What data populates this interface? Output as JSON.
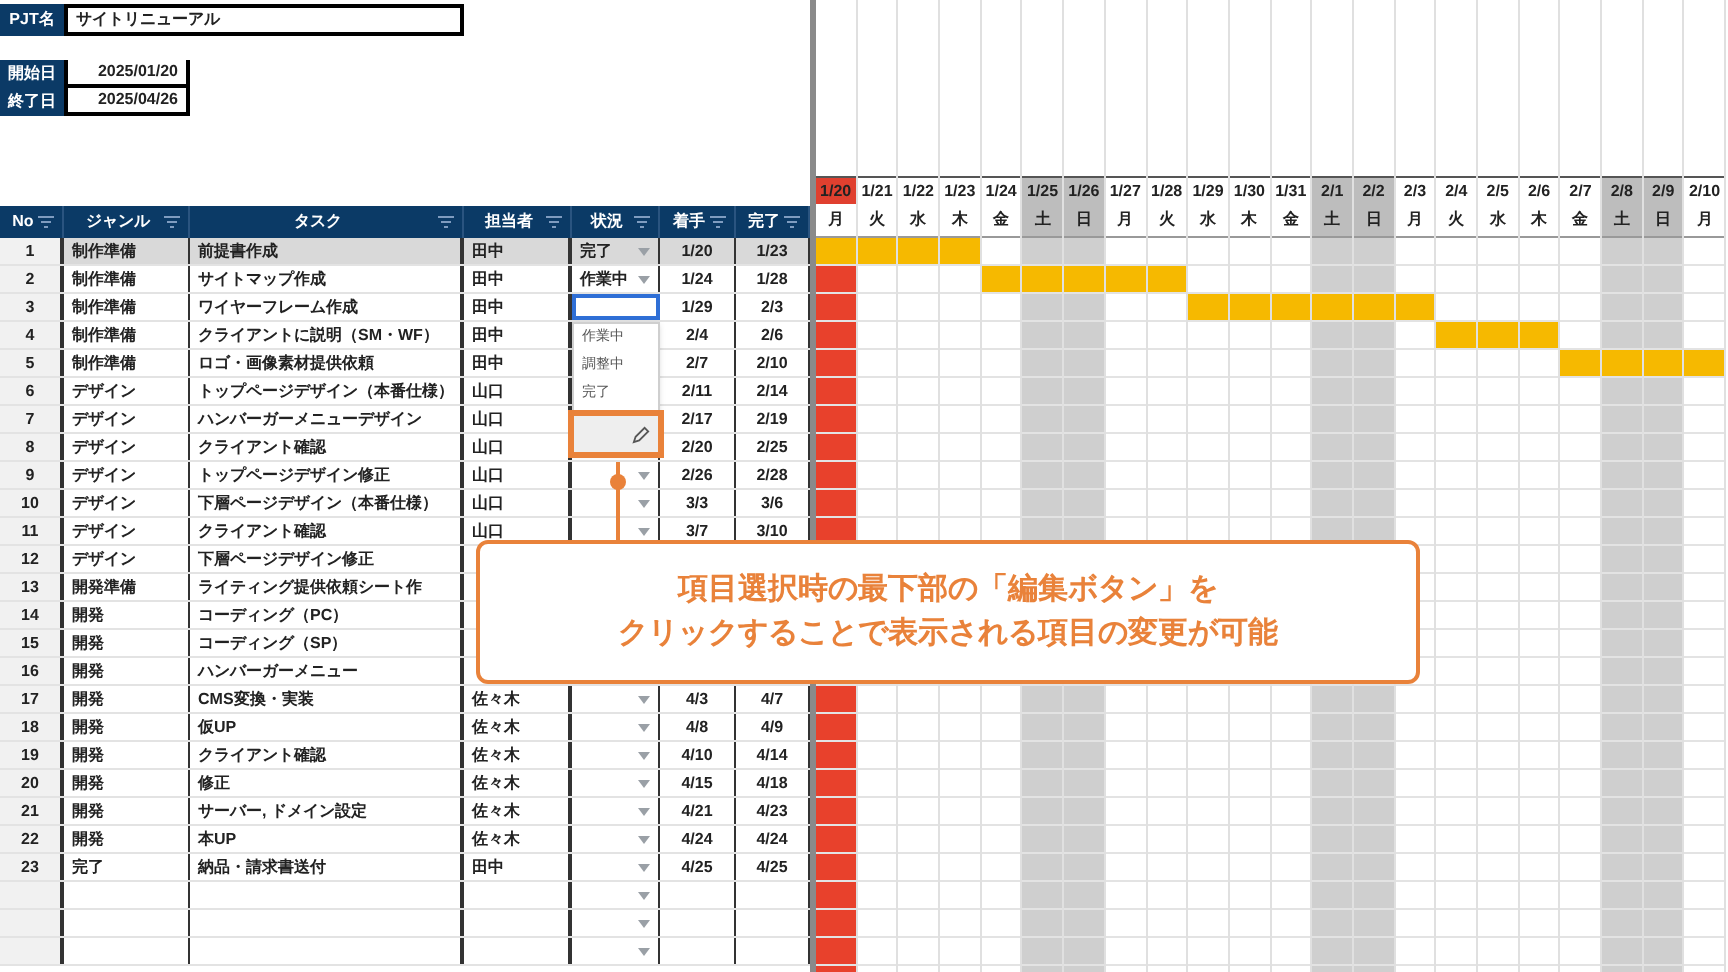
{
  "project": {
    "label": "PJT名",
    "value": "サイトリニューアル"
  },
  "dates": [
    {
      "label": "開始日",
      "value": "2025/01/20"
    },
    {
      "label": "終了日",
      "value": "2025/04/26"
    }
  ],
  "table": {
    "columns": [
      "No",
      "ジャンル",
      "タスク",
      "担当者",
      "状況",
      "着手",
      "完了"
    ],
    "rows": [
      {
        "no": "1",
        "genre": "制作準備",
        "task": "前提書作成",
        "assignee": "田中",
        "status": "完了",
        "start": "1/20",
        "end": "1/23",
        "highlighted": true,
        "status_selected": false,
        "caret": true
      },
      {
        "no": "2",
        "genre": "制作準備",
        "task": "サイトマップ作成",
        "assignee": "田中",
        "status": "作業中",
        "start": "1/24",
        "end": "1/28",
        "highlighted": false,
        "status_selected": false,
        "caret": true
      },
      {
        "no": "3",
        "genre": "制作準備",
        "task": "ワイヤーフレーム作成",
        "assignee": "田中",
        "start": "1/29",
        "end": "2/3",
        "highlighted": false,
        "status_selected": true
      },
      {
        "no": "4",
        "genre": "制作準備",
        "task": "クライアントに説明（SM・WF）",
        "assignee": "田中",
        "start": "2/4",
        "end": "2/6",
        "highlighted": false
      },
      {
        "no": "5",
        "genre": "制作準備",
        "task": "ロゴ・画像素材提供依頼",
        "assignee": "田中",
        "start": "2/7",
        "end": "2/10",
        "highlighted": false
      },
      {
        "no": "6",
        "genre": "デザイン",
        "task": "トップページデザイン（本番仕様）",
        "assignee": "山口",
        "start": "2/11",
        "end": "2/14",
        "highlighted": false
      },
      {
        "no": "7",
        "genre": "デザイン",
        "task": "ハンバーガーメニューデザイン",
        "assignee": "山口",
        "start": "2/17",
        "end": "2/19",
        "highlighted": false
      },
      {
        "no": "8",
        "genre": "デザイン",
        "task": "クライアント確認",
        "assignee": "山口",
        "start": "2/20",
        "end": "2/25",
        "highlighted": false
      },
      {
        "no": "9",
        "genre": "デザイン",
        "task": "トップページデザイン修正",
        "assignee": "山口",
        "start": "2/26",
        "end": "2/28",
        "highlighted": false,
        "status_selected": false,
        "caret": true
      },
      {
        "no": "10",
        "genre": "デザイン",
        "task": "下層ページデザイン（本番仕様）",
        "assignee": "山口",
        "start": "3/3",
        "end": "3/6",
        "highlighted": false,
        "status_selected": false,
        "caret": true
      },
      {
        "no": "11",
        "genre": "デザイン",
        "task": "クライアント確認",
        "assignee": "山口",
        "start": "3/7",
        "end": "3/10",
        "highlighted": false,
        "status_selected": false,
        "caret": true
      },
      {
        "no": "12",
        "genre": "デザイン",
        "task": "下層ページデザイン修正",
        "highlighted": false
      },
      {
        "no": "13",
        "genre": "開発準備",
        "task": "ライティング提供依頼シート作",
        "highlighted": false
      },
      {
        "no": "14",
        "genre": "開発",
        "task": "コーディング（PC）",
        "highlighted": false
      },
      {
        "no": "15",
        "genre": "開発",
        "task": "コーディング（SP）",
        "highlighted": false
      },
      {
        "no": "16",
        "genre": "開発",
        "task": "ハンバーガーメニュー",
        "highlighted": false
      },
      {
        "no": "17",
        "genre": "開発",
        "task": "CMS変換・実装",
        "assignee": "佐々木",
        "start": "4/3",
        "end": "4/7",
        "highlighted": false,
        "status_selected": false,
        "caret": true
      },
      {
        "no": "18",
        "genre": "開発",
        "task": "仮UP",
        "assignee": "佐々木",
        "start": "4/8",
        "end": "4/9",
        "highlighted": false,
        "status_selected": false,
        "caret": true
      },
      {
        "no": "19",
        "genre": "開発",
        "task": "クライアント確認",
        "assignee": "佐々木",
        "start": "4/10",
        "end": "4/14",
        "highlighted": false,
        "status_selected": false,
        "caret": true
      },
      {
        "no": "20",
        "genre": "開発",
        "task": "修正",
        "assignee": "佐々木",
        "start": "4/15",
        "end": "4/18",
        "highlighted": false,
        "status_selected": false,
        "caret": true
      },
      {
        "no": "21",
        "genre": "開発",
        "task": "サーバー, ドメイン設定",
        "assignee": "佐々木",
        "start": "4/21",
        "end": "4/23",
        "highlighted": false,
        "status_selected": false,
        "caret": true
      },
      {
        "no": "22",
        "genre": "開発",
        "task": "本UP",
        "assignee": "佐々木",
        "start": "4/24",
        "end": "4/24",
        "highlighted": false,
        "status_selected": false,
        "caret": true
      },
      {
        "no": "23",
        "genre": "完了",
        "task": "納品・請求書送付",
        "assignee": "田中",
        "start": "4/25",
        "end": "4/25",
        "highlighted": false,
        "status_selected": false,
        "caret": true
      },
      {
        "highlighted": false,
        "status_selected": false,
        "caret": true
      },
      {
        "highlighted": false,
        "status_selected": false,
        "caret": true
      },
      {
        "highlighted": false,
        "status_selected": false,
        "caret": true
      }
    ]
  },
  "status_menu": {
    "options": [
      "作業中",
      "調整中",
      "完了"
    ],
    "edit_highlighted": true
  },
  "gantt": {
    "days": [
      {
        "date": "1/20",
        "weekday": "月",
        "weekend": false,
        "today": true
      },
      {
        "date": "1/21",
        "weekday": "火",
        "weekend": false,
        "today": false
      },
      {
        "date": "1/22",
        "weekday": "水",
        "weekend": false,
        "today": false
      },
      {
        "date": "1/23",
        "weekday": "木",
        "weekend": false,
        "today": false
      },
      {
        "date": "1/24",
        "weekday": "金",
        "weekend": false,
        "today": false
      },
      {
        "date": "1/25",
        "weekday": "土",
        "weekend": true,
        "today": false
      },
      {
        "date": "1/26",
        "weekday": "日",
        "weekend": true,
        "today": false
      },
      {
        "date": "1/27",
        "weekday": "月",
        "weekend": false,
        "today": false
      },
      {
        "date": "1/28",
        "weekday": "火",
        "weekend": false,
        "today": false
      },
      {
        "date": "1/29",
        "weekday": "水",
        "weekend": false,
        "today": false
      },
      {
        "date": "1/30",
        "weekday": "木",
        "weekend": false,
        "today": false
      },
      {
        "date": "1/31",
        "weekday": "金",
        "weekend": false,
        "today": false
      },
      {
        "date": "2/1",
        "weekday": "土",
        "weekend": true,
        "today": false
      },
      {
        "date": "2/2",
        "weekday": "日",
        "weekend": true,
        "today": false
      },
      {
        "date": "2/3",
        "weekday": "月",
        "weekend": false,
        "today": false
      },
      {
        "date": "2/4",
        "weekday": "火",
        "weekend": false,
        "today": false
      },
      {
        "date": "2/5",
        "weekday": "水",
        "weekend": false,
        "today": false
      },
      {
        "date": "2/6",
        "weekday": "木",
        "weekend": false,
        "today": false
      },
      {
        "date": "2/7",
        "weekday": "金",
        "weekend": false,
        "today": false
      },
      {
        "date": "2/8",
        "weekday": "土",
        "weekend": true,
        "today": false
      },
      {
        "date": "2/9",
        "weekday": "日",
        "weekend": true,
        "today": false
      },
      {
        "date": "2/10",
        "weekday": "月",
        "weekend": false,
        "today": false
      }
    ]
  },
  "callout": {
    "lines": [
      "項目選択時の最下部の「編集ボタン」を",
      "クリックすることで表示される項目の変更が可能"
    ]
  }
}
